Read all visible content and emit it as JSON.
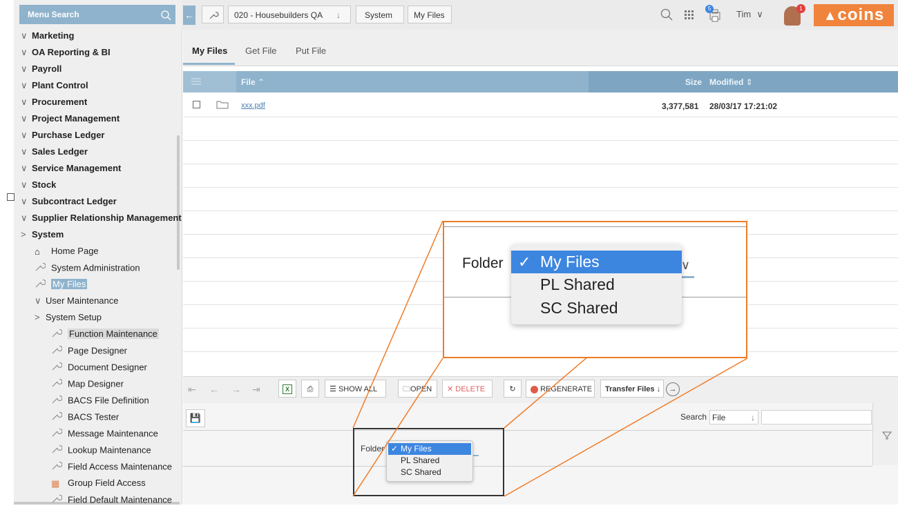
{
  "sidebar": {
    "search_label": "Menu Search",
    "top_items": [
      "Marketing",
      "OA Reporting & BI",
      "Payroll",
      "Plant Control",
      "Procurement",
      "Project Management",
      "Purchase Ledger",
      "Sales Ledger",
      "Service Management",
      "Stock",
      "Subcontract Ledger",
      "Supplier Relationship Management",
      "System"
    ],
    "system_children": [
      "Home Page",
      "System Administration",
      "My Files",
      "User Maintenance",
      "System Setup"
    ],
    "setup_children": [
      "Function Maintenance",
      "Page Designer",
      "Document Designer",
      "Map Designer",
      "BACS File Definition",
      "BACS Tester",
      "Message Maintenance",
      "Lookup Maintenance",
      "Field Access Maintenance",
      "Group Field Access",
      "Field Default Maintenance"
    ]
  },
  "header": {
    "company": "020 - Housebuilders QA",
    "breadcrumb_system": "System",
    "breadcrumb_page": "My Files",
    "user": "Tim",
    "print_badge": "5",
    "notify_badge": "1",
    "brand": "coins"
  },
  "tabs": [
    "My Files",
    "Get File",
    "Put File"
  ],
  "grid": {
    "columns": {
      "file": "File",
      "size": "Size",
      "modified": "Modified"
    },
    "rows": [
      {
        "file": "xxx.pdf",
        "size": "3,377,581",
        "modified": "28/03/17 17:21:02"
      }
    ]
  },
  "toolbar": {
    "show_all": "SHOW ALL",
    "open": "OPEN",
    "delete": "DELETE",
    "regenerate": "REGENERATE",
    "transfer": "Transfer Files"
  },
  "search": {
    "label": "Search",
    "field": "File"
  },
  "folder": {
    "label": "Folder",
    "options": [
      "My Files",
      "PL Shared",
      "SC Shared"
    ],
    "selected_mark": "✓"
  },
  "colors": {
    "accent": "#8fb3cc",
    "brand": "#f0843c",
    "callout": "#f07b26",
    "select": "#3d86e0"
  }
}
